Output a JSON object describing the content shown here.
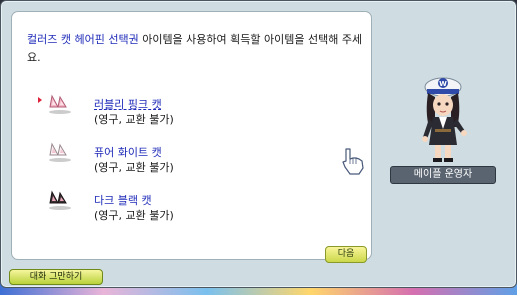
{
  "dialog": {
    "message_part1": "컬러즈 캣 헤어핀 선택권",
    "message_part2": " 아이템을 사용하여 획득할 아이템을 선택해 주세요.",
    "options": [
      {
        "name": "러블리 핑크 캣",
        "note": "(영구, 교환 불가)",
        "icon": "pink-cat-hairpin-icon",
        "selected": true
      },
      {
        "name": "퓨어 화이트 캣",
        "note": "(영구, 교환 불가)",
        "icon": "white-cat-hairpin-icon",
        "selected": false
      },
      {
        "name": "다크 블랙 캣",
        "note": "(영구, 교환 불가)",
        "icon": "black-cat-hairpin-icon",
        "selected": false
      }
    ],
    "next_label": "다음",
    "end_label": "대화 그만하기"
  },
  "npc": {
    "name": "메이플 운영자",
    "hat_letter": "W"
  },
  "colors": {
    "highlight": "#1f2bb8",
    "window_bg": "#cfdce2",
    "button_green": "#cbd84a"
  }
}
